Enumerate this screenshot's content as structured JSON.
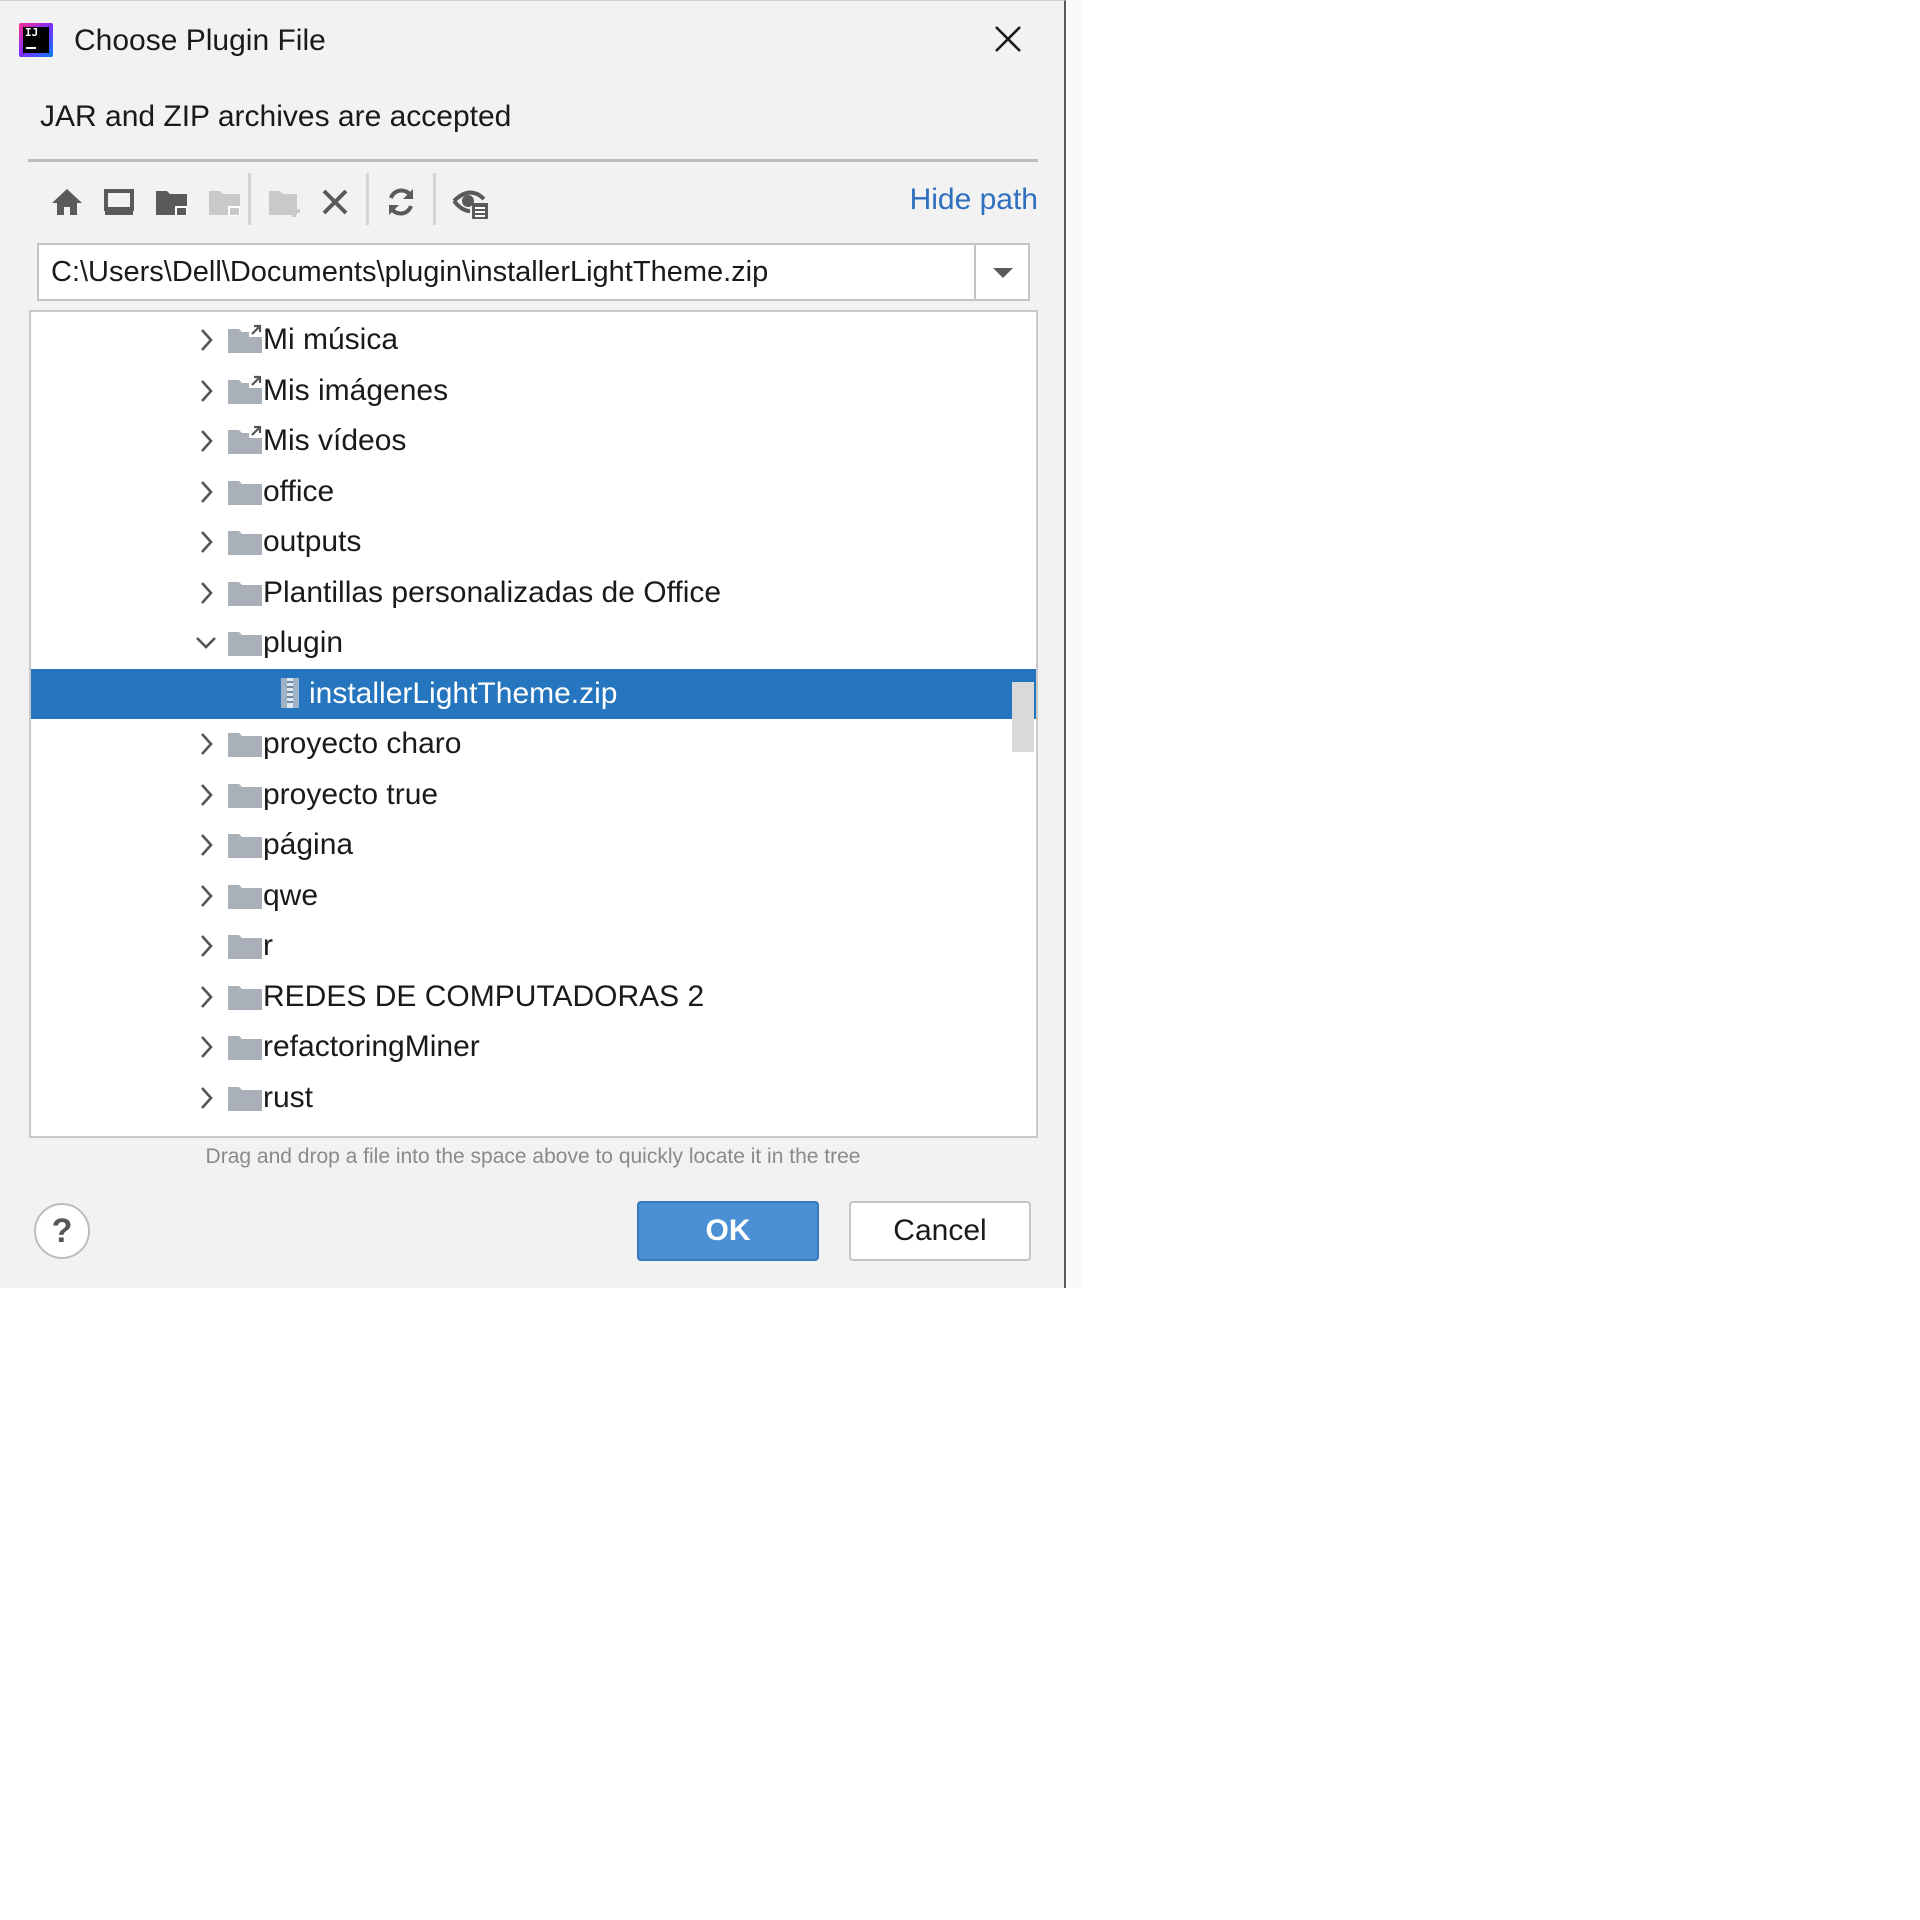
{
  "dialog": {
    "title": "Choose Plugin File",
    "app_icon_text": "IJ",
    "description": "JAR and ZIP archives are accepted",
    "hint": "Drag and drop a file into the space above to quickly locate it in the tree",
    "colors": {
      "selection": "#2675bf",
      "ok_button": "#4b8fd4",
      "link": "#2e6fbf"
    }
  },
  "toolbar": {
    "buttons": [
      "home-icon",
      "desktop-icon",
      "project-folder-icon",
      "module-folder-icon",
      "new-folder-icon",
      "delete-icon",
      "refresh-icon",
      "show-hidden-icon"
    ],
    "hide_path_label": "Hide path"
  },
  "path": {
    "value": "C:\\Users\\Dell\\Documents\\plugin\\installerLightTheme.zip"
  },
  "tree": {
    "items": [
      {
        "label": "Mi música",
        "type": "folder-link",
        "expanded": false,
        "selected": false
      },
      {
        "label": "Mis imágenes",
        "type": "folder-link",
        "expanded": false,
        "selected": false
      },
      {
        "label": "Mis vídeos",
        "type": "folder-link",
        "expanded": false,
        "selected": false
      },
      {
        "label": "office",
        "type": "folder",
        "expanded": false,
        "selected": false
      },
      {
        "label": "outputs",
        "type": "folder",
        "expanded": false,
        "selected": false
      },
      {
        "label": "Plantillas personalizadas de Office",
        "type": "folder",
        "expanded": false,
        "selected": false
      },
      {
        "label": "plugin",
        "type": "folder",
        "expanded": true,
        "selected": false
      },
      {
        "label": "installerLightTheme.zip",
        "type": "zip",
        "expanded": false,
        "selected": true
      },
      {
        "label": "proyecto charo",
        "type": "folder",
        "expanded": false,
        "selected": false
      },
      {
        "label": "proyecto true",
        "type": "folder",
        "expanded": false,
        "selected": false
      },
      {
        "label": "página",
        "type": "folder",
        "expanded": false,
        "selected": false
      },
      {
        "label": "qwe",
        "type": "folder",
        "expanded": false,
        "selected": false
      },
      {
        "label": "r",
        "type": "folder",
        "expanded": false,
        "selected": false
      },
      {
        "label": "REDES DE COMPUTADORAS 2",
        "type": "folder",
        "expanded": false,
        "selected": false
      },
      {
        "label": "refactoringMiner",
        "type": "folder",
        "expanded": false,
        "selected": false
      },
      {
        "label": "rust",
        "type": "folder",
        "expanded": false,
        "selected": false
      }
    ]
  },
  "buttons": {
    "help": "?",
    "ok": "OK",
    "cancel": "Cancel"
  }
}
